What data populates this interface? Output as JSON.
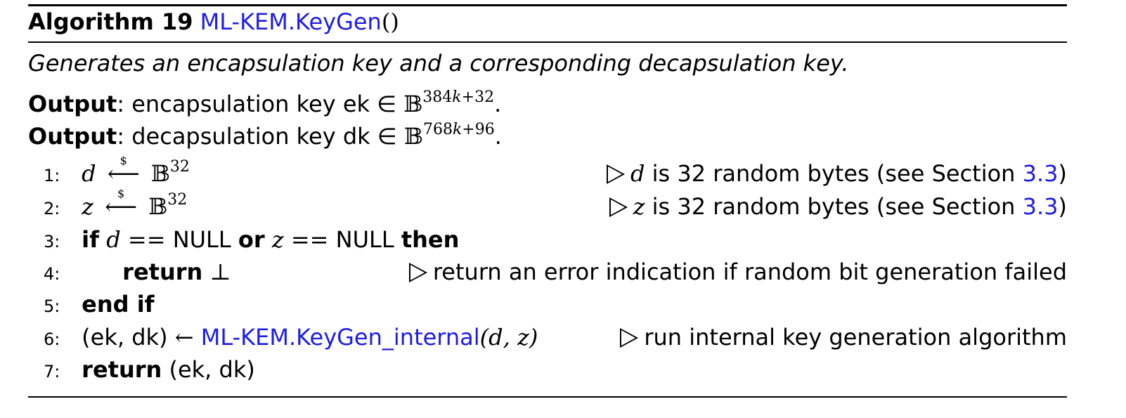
{
  "header": {
    "algorithm_label": "Algorithm 19",
    "function_name": "ML-KEM.KeyGen",
    "function_parens": "()"
  },
  "description": "Generates an encapsulation key and a corresponding decapsulation key.",
  "outputs": [
    {
      "label": "Output",
      "text": ": encapsulation key ek ∈ ",
      "set": "𝔹",
      "exponent_prefix": "384",
      "exponent_var": "k",
      "exponent_suffix": "+32",
      "end": "."
    },
    {
      "label": "Output",
      "text": ": decapsulation key dk ∈ ",
      "set": "𝔹",
      "exponent_prefix": "768",
      "exponent_var": "k",
      "exponent_suffix": "+96",
      "end": "."
    }
  ],
  "steps": [
    {
      "num": "1:",
      "var": "d",
      "arrow": "⟵",
      "dollar": "$",
      "set": "𝔹",
      "exp": "32"
    },
    {
      "num": "2:",
      "var": "z",
      "arrow": "⟵",
      "dollar": "$",
      "set": "𝔹",
      "exp": "32"
    },
    {
      "num": "3:",
      "kw_if": "if",
      "d": "d",
      "eq": "==",
      "null1": "NULL",
      "kw_or": "or",
      "z": "z",
      "eq2": "==",
      "null2": "NULL",
      "kw_then": "then"
    },
    {
      "num": "4:",
      "kw_return": "return",
      "bottom": "⊥"
    },
    {
      "num": "5:",
      "kw_end_if": "end if"
    },
    {
      "num": "6:",
      "lhs": "(ek, dk)",
      "arrow": "←",
      "fn": "ML-KEM.KeyGen_internal",
      "args": "(d, z)"
    },
    {
      "num": "7:",
      "kw_return": "return",
      "rhs": "(ek, dk)"
    }
  ],
  "comments": {
    "c1": {
      "var": "d",
      "text_pre": " is 32 random bytes (see Section ",
      "ref": "3.3",
      "text_post": ")"
    },
    "c2": {
      "var": "z",
      "text_pre": " is 32 random bytes (see Section ",
      "ref": "3.3",
      "text_post": ")"
    },
    "c4": {
      "text": "return an error indication if random bit generation failed"
    },
    "c6": {
      "text": "run internal key generation algorithm"
    }
  },
  "colors": {
    "link": "#1d1de6",
    "text": "#000000"
  }
}
